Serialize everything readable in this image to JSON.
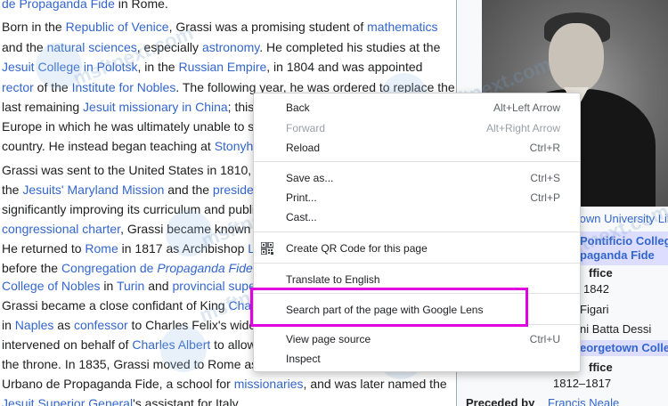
{
  "article": {
    "lines": [
      {
        "segs": [
          {
            "t": "de Propaganda Fide",
            "link": true
          },
          {
            "t": " in Rome.",
            "link": false
          }
        ]
      },
      {
        "segs": [
          {
            "t": "Born in the ",
            "link": false
          },
          {
            "t": "Republic of Venice",
            "link": true
          },
          {
            "t": ", Grassi was a promising student of ",
            "link": false
          },
          {
            "t": "mathematics",
            "link": true
          }
        ]
      },
      {
        "segs": [
          {
            "t": "and the ",
            "link": false
          },
          {
            "t": "natural sciences",
            "link": true
          },
          {
            "t": ", especially ",
            "link": false
          },
          {
            "t": "astronomy",
            "link": true
          },
          {
            "t": ". He completed his studies at the",
            "link": false
          }
        ]
      },
      {
        "segs": [
          {
            "t": "Jesuit College in Polotsk",
            "link": true
          },
          {
            "t": ", in the ",
            "link": false
          },
          {
            "t": "Russian Empire",
            "link": true
          },
          {
            "t": ", in 1804 and was appointed",
            "link": false
          }
        ]
      },
      {
        "segs": [
          {
            "t": "rector",
            "link": true
          },
          {
            "t": " of the ",
            "link": false
          },
          {
            "t": "Institute for Nobles",
            "link": true
          },
          {
            "t": ". The following year, he was ordered to replace the",
            "link": false
          }
        ]
      },
      {
        "segs": [
          {
            "t": "last remaining ",
            "link": false
          },
          {
            "t": "Jesuit missionary in China",
            "link": true
          },
          {
            "t": "; this",
            "link": false
          }
        ]
      },
      {
        "segs": [
          {
            "t": "Europe in which he was ultimately unable to se",
            "link": false
          }
        ]
      },
      {
        "segs": [
          {
            "t": "country. He instead began teaching at ",
            "link": false
          },
          {
            "t": "Stonyhu",
            "link": true
          }
        ]
      },
      {
        "segs": [
          {
            "t": "Grassi was sent to the United States in 1810, ",
            "link": false
          }
        ]
      },
      {
        "segs": [
          {
            "t": "the ",
            "link": false
          },
          {
            "t": "Jesuits' Maryland Mission",
            "link": true
          },
          {
            "t": " and the ",
            "link": false
          },
          {
            "t": "presider",
            "link": true
          }
        ]
      },
      {
        "segs": [
          {
            "t": "significantly improving its curriculum and public",
            "link": false
          }
        ]
      },
      {
        "segs": [
          {
            "t": "congressional charter",
            "link": true
          },
          {
            "t": ", Grassi became known a",
            "link": false
          }
        ]
      },
      {
        "segs": [
          {
            "t": "He returned to ",
            "link": false
          },
          {
            "t": "Rome",
            "link": true
          },
          {
            "t": " in 1817 as Archbishop ",
            "link": false
          },
          {
            "t": "Lo",
            "link": true
          }
        ]
      },
      {
        "segs": [
          {
            "t": "before the ",
            "link": false
          },
          {
            "t": "Congregation de ",
            "link": true
          },
          {
            "t": "Propaganda Fide",
            "link": true,
            "italic": true
          },
          {
            "t": ".",
            "link": false
          }
        ]
      },
      {
        "segs": [
          {
            "t": "College of Nobles",
            "link": true
          },
          {
            "t": " in ",
            "link": false
          },
          {
            "t": "Turin",
            "link": true
          },
          {
            "t": " and ",
            "link": false
          },
          {
            "t": "provincial supe",
            "link": true
          }
        ]
      },
      {
        "segs": [
          {
            "t": "Grassi became a close confidant of King ",
            "link": false
          },
          {
            "t": "Char",
            "link": true
          }
        ]
      },
      {
        "segs": [
          {
            "t": "in ",
            "link": false
          },
          {
            "t": "Naples",
            "link": true
          },
          {
            "t": " as ",
            "link": false
          },
          {
            "t": "confessor",
            "link": true
          },
          {
            "t": " to Charles Felix's wido",
            "link": false
          }
        ]
      },
      {
        "segs": [
          {
            "t": "intervened on behalf of ",
            "link": false
          },
          {
            "t": "Charles Albert",
            "link": true
          },
          {
            "t": " to allow",
            "link": false
          }
        ]
      },
      {
        "segs": [
          {
            "t": "the throne. In 1835, Grassi moved to Rome as",
            "link": false
          }
        ]
      },
      {
        "segs": [
          {
            "t": "Urbano de Propaganda Fide, a school for ",
            "link": false
          },
          {
            "t": "missionaries",
            "link": true
          },
          {
            "t": ", and was later named the",
            "link": false
          }
        ]
      },
      {
        "segs": [
          {
            "t": "Jesuit Superior General",
            "link": true
          },
          {
            "t": "'s assistant for Italy.",
            "link": false
          }
        ]
      }
    ]
  },
  "infobox": {
    "caption": "town University Libr",
    "institution_line1": "Pontificio Collegio",
    "institution_line2": "paganda Fide",
    "office_label": "ffice",
    "office_years": "1842",
    "predecessor": "Figari",
    "successor": "ni Batta Dessi",
    "institution2": "eorgetown College",
    "office_label2": "ffice",
    "office_years2": "1812–1817",
    "preceded_by_label": "Preceded by",
    "preceded_by_value": "Francis Neale"
  },
  "watermark": {
    "text": "msftnext.com"
  },
  "context_menu": {
    "items": [
      {
        "label": "Back",
        "shortcut": "Alt+Left Arrow",
        "disabled": false
      },
      {
        "label": "Forward",
        "shortcut": "Alt+Right Arrow",
        "disabled": true
      },
      {
        "label": "Reload",
        "shortcut": "Ctrl+R",
        "disabled": false
      },
      {
        "label": "Save as...",
        "shortcut": "Ctrl+S",
        "disabled": false
      },
      {
        "label": "Print...",
        "shortcut": "Ctrl+P",
        "disabled": false
      },
      {
        "label": "Cast...",
        "shortcut": "",
        "disabled": false
      },
      {
        "label": "Create QR Code for this page",
        "shortcut": "",
        "disabled": false,
        "icon": "qr-code-icon"
      },
      {
        "label": "Translate to English",
        "shortcut": "",
        "disabled": false
      },
      {
        "label": "Search part of the page with Google Lens",
        "shortcut": "",
        "disabled": false
      },
      {
        "label": "View page source",
        "shortcut": "Ctrl+U",
        "disabled": false
      },
      {
        "label": "Inspect",
        "shortcut": "",
        "disabled": false
      }
    ],
    "highlight_color": "#e000e0"
  }
}
